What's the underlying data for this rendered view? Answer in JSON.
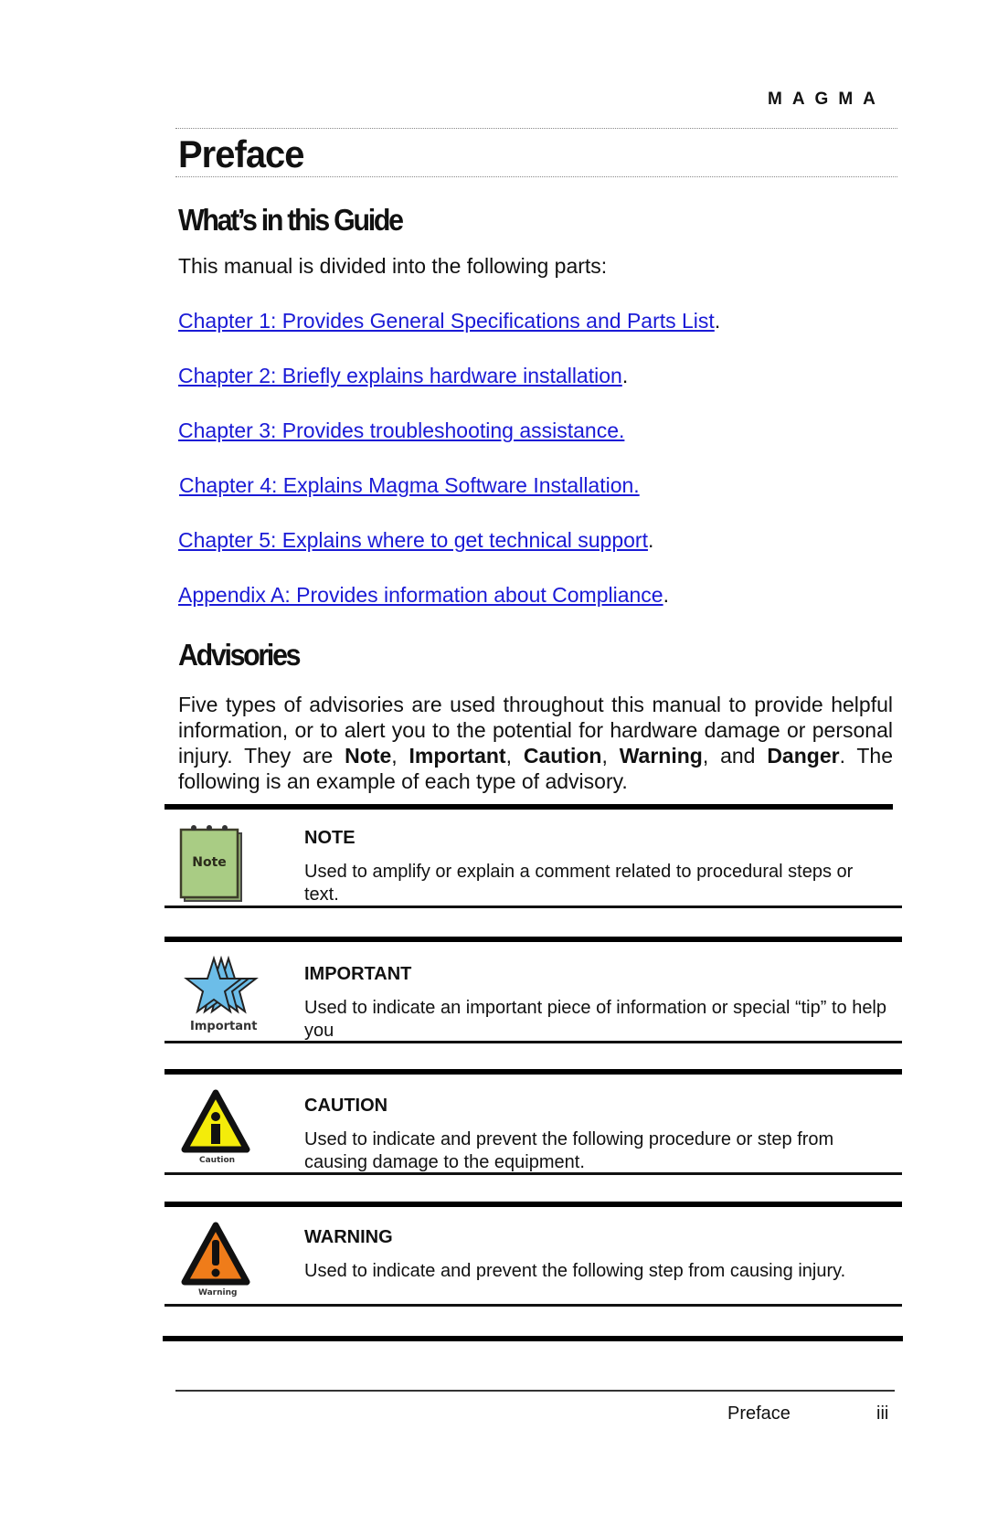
{
  "header": {
    "brand": "MAGMA"
  },
  "page_title": "Preface",
  "guide_section": {
    "heading": "What’s in this Guide",
    "intro": "This manual is divided into the following parts:",
    "links": [
      {
        "text": "Chapter 1:  Provides General Specifications and Parts List",
        "suffix": "."
      },
      {
        "text": "Chapter 2:  Briefly explains hardware installation",
        "suffix": "."
      },
      {
        "text": "Chapter 3:  Provides troubleshooting assistance.",
        "suffix": ""
      },
      {
        "text": "Chapter 4:  Explains Magma Software Installation.",
        "suffix": ""
      },
      {
        "text": "Chapter 5:  Explains where to get technical support",
        "suffix": "."
      },
      {
        "text": "Appendix A: Provides information about Compliance",
        "suffix": "."
      }
    ]
  },
  "advisories_section": {
    "heading": "Advisories",
    "paragraph": {
      "part1": "Five types of advisories are used throughout this manual to provide helpful information, or to alert you to the potential for hardware damage or personal injury. They are ",
      "note": "Note",
      "sep1": ", ",
      "important": "Important",
      "sep2": ", ",
      "caution": "Caution",
      "sep3": ", ",
      "warning": "Warning",
      "sep4": ", and ",
      "danger": "Danger",
      "part2": ". The following is an example of each type of advisory."
    },
    "items": [
      {
        "type": "note",
        "heading": "NOTE",
        "text": "Used to amplify or explain a comment related to procedural steps or text.",
        "icon_label": "Note",
        "icon_color": "#a9cc84"
      },
      {
        "type": "important",
        "heading": "IMPORTANT",
        "text": "Used to indicate an important piece of information or special “tip” to help you",
        "icon_label": "Important",
        "icon_color": "#6cbde8"
      },
      {
        "type": "caution",
        "heading": "CAUTION",
        "text": "Used to indicate and prevent the following procedure or step from causing damage to the equipment.",
        "icon_label": "Caution",
        "icon_color": "#f4ec0a"
      },
      {
        "type": "warning",
        "heading": "WARNING",
        "text": "Used to indicate and prevent the following step from causing injury.",
        "icon_label": "Warning",
        "icon_color": "#ef7c1a"
      }
    ]
  },
  "footer": {
    "section_label": "Preface",
    "page_number": "iii"
  },
  "colors": {
    "link": "#1a1ad6",
    "text": "#111111"
  }
}
